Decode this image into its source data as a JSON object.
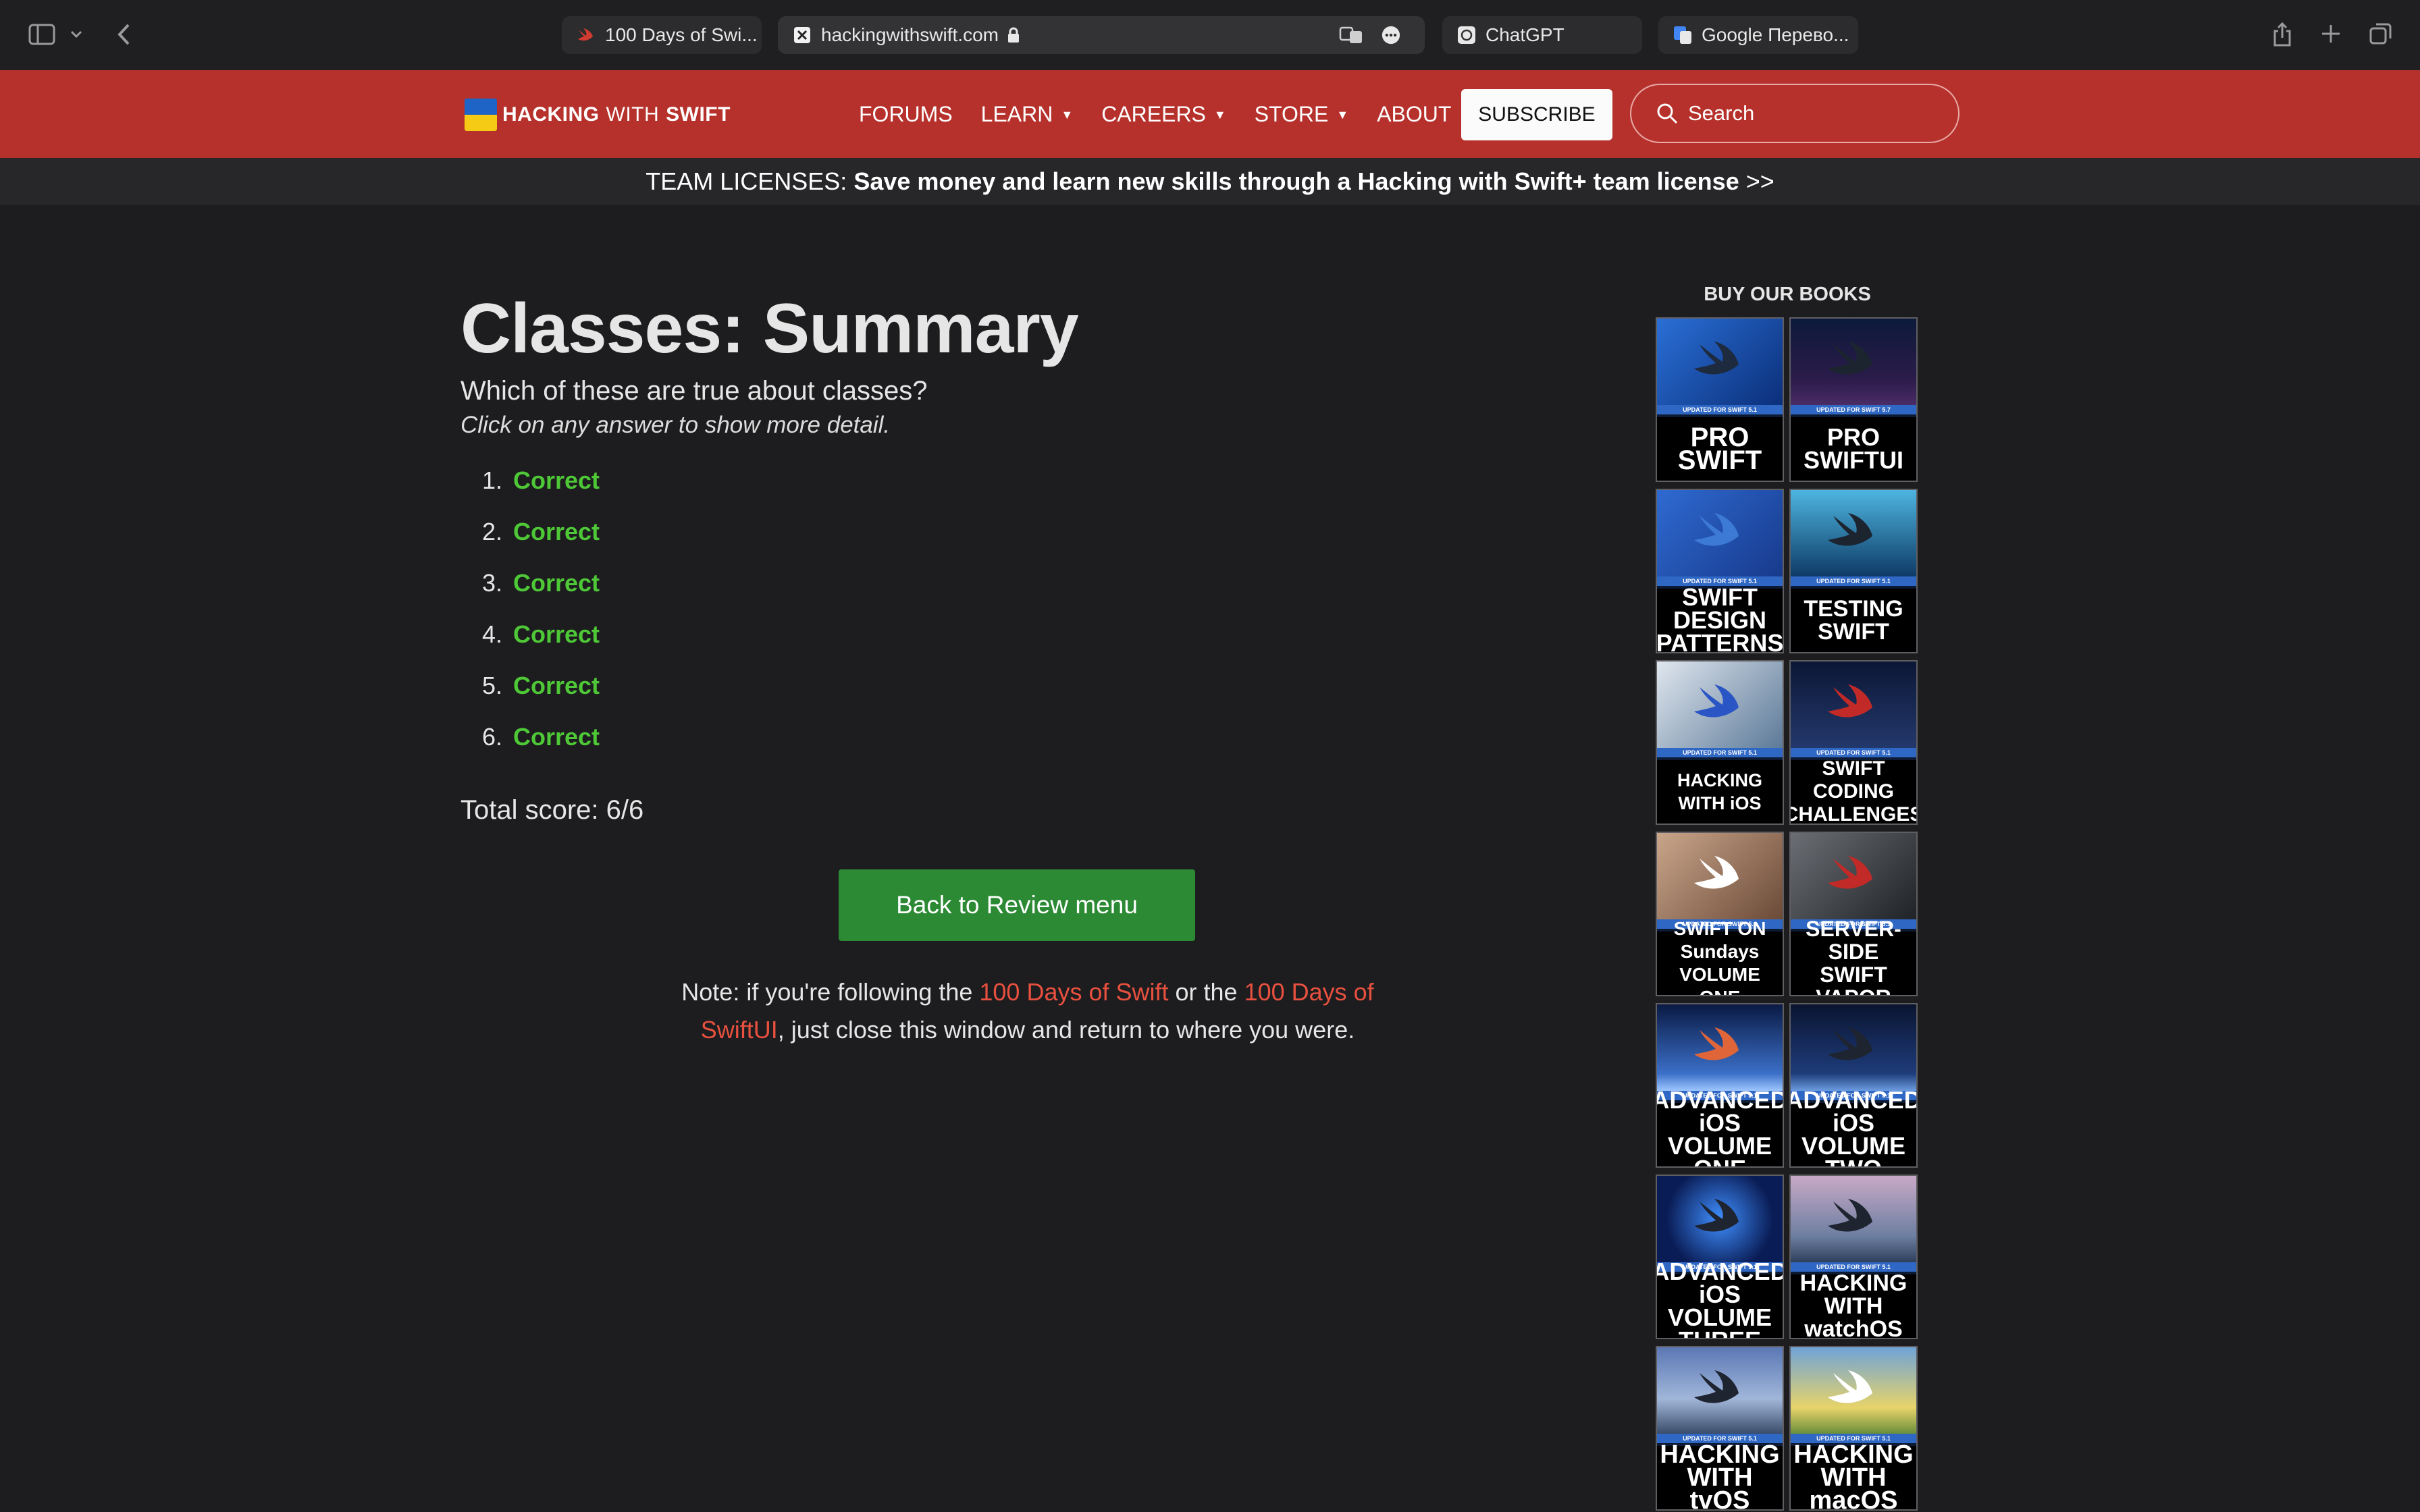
{
  "browser": {
    "tabs": [
      {
        "label": "100 Days of Swi..."
      },
      {
        "label": "hackingwithswift.com"
      },
      {
        "label": "ChatGPT"
      },
      {
        "label": "Google Перево..."
      }
    ]
  },
  "site": {
    "brand": {
      "part1": "HACKING",
      "part2": "WITH",
      "part3": "SWIFT"
    },
    "nav": [
      "FORUMS",
      "LEARN",
      "CAREERS",
      "STORE",
      "ABOUT"
    ],
    "subscribe": "SUBSCRIBE",
    "search_placeholder": "Search"
  },
  "banner": {
    "prefix": "TEAM LICENSES:",
    "text": "Save money and learn new skills through a Hacking with Swift+ team license",
    "suffix": ">>"
  },
  "main": {
    "title": "Classes: Summary",
    "question": "Which of these are true about classes?",
    "hint": "Click on any answer to show more detail.",
    "answers": [
      {
        "num": "1.",
        "label": "Correct"
      },
      {
        "num": "2.",
        "label": "Correct"
      },
      {
        "num": "3.",
        "label": "Correct"
      },
      {
        "num": "4.",
        "label": "Correct"
      },
      {
        "num": "5.",
        "label": "Correct"
      },
      {
        "num": "6.",
        "label": "Correct"
      }
    ],
    "score": "Total score: 6/6",
    "back_button": "Back to Review menu",
    "note": {
      "t1": "Note: if you're following the ",
      "link1": "100 Days of Swift",
      "t2": " or the ",
      "link2": "100 Days of SwiftUI",
      "t3": ", just close this window and return to where you were."
    }
  },
  "sidebar": {
    "title": "BUY OUR BOOKS",
    "books": [
      {
        "title": "PRO SWIFT",
        "strip": "UPDATED FOR SWIFT 5.1"
      },
      {
        "title": "PRO SWIFTUI",
        "strip": "UPDATED FOR SWIFT 5.7"
      },
      {
        "title": "SWIFT DESIGN PATTERNS",
        "strip": "UPDATED FOR SWIFT 5.1"
      },
      {
        "title": "TESTING SWIFT",
        "strip": "UPDATED FOR SWIFT 5.1"
      },
      {
        "title": "HACKING WITH iOS",
        "strip": "UPDATED FOR SWIFT 5.1"
      },
      {
        "title": "SWIFT CODING CHALLENGES",
        "strip": "UPDATED FOR SWIFT 5.1"
      },
      {
        "title": "SWIFT ON Sundays VOLUME ONE",
        "strip": "UPDATED FOR SWIFT 5.1"
      },
      {
        "title": "SERVER-SIDE SWIFT VAPOR",
        "strip": "UPDATED FOR SWIFT 5.1"
      },
      {
        "title": "ADVANCED iOS VOLUME ONE",
        "strip": "UPDATED FOR SWIFT 5.1"
      },
      {
        "title": "ADVANCED iOS VOLUME TWO",
        "strip": "UPDATED FOR SWIFT 5.1"
      },
      {
        "title": "ADVANCED iOS VOLUME THREE",
        "strip": "UPDATED FOR SWIFT 5.1"
      },
      {
        "title": "HACKING WITH watchOS",
        "strip": "UPDATED FOR SWIFT 5.1"
      },
      {
        "title": "HACKING WITH tvOS",
        "strip": "UPDATED FOR SWIFT 5.1"
      },
      {
        "title": "HACKING WITH macOS",
        "strip": "UPDATED FOR SWIFT 5.1"
      }
    ]
  },
  "colors": {
    "nav_red": "#b6312c",
    "correct_green": "#4ec837",
    "button_green": "#2c8a34",
    "link_red": "#e8503f"
  }
}
